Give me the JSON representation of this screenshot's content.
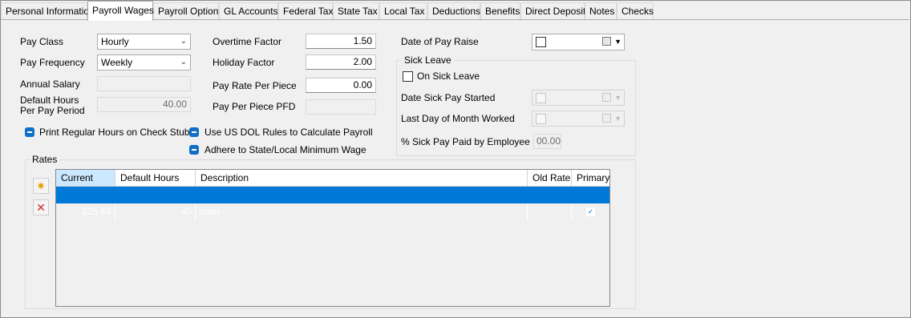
{
  "tabs": [
    {
      "label": "Personal Information"
    },
    {
      "label": "Payroll Wages"
    },
    {
      "label": "Payroll Options"
    },
    {
      "label": "GL Accounts"
    },
    {
      "label": "Federal Tax"
    },
    {
      "label": "State Tax"
    },
    {
      "label": "Local Tax"
    },
    {
      "label": "Deductions"
    },
    {
      "label": "Benefits"
    },
    {
      "label": "Direct Deposit"
    },
    {
      "label": "Notes"
    },
    {
      "label": "Checks"
    }
  ],
  "active_tab": "Payroll Wages",
  "left": {
    "pay_class_label": "Pay Class",
    "pay_class_value": "Hourly",
    "pay_frequency_label": "Pay Frequency",
    "pay_frequency_value": "Weekly",
    "annual_salary_label": "Annual Salary",
    "annual_salary_value": "",
    "default_hours_label_1": "Default Hours",
    "default_hours_label_2": "Per Pay Period",
    "default_hours_value": "40.00"
  },
  "middle": {
    "overtime_factor_label": "Overtime Factor",
    "overtime_factor_value": "1.50",
    "holiday_factor_label": "Holiday Factor",
    "holiday_factor_value": "2.00",
    "pay_rate_per_piece_label": "Pay Rate Per Piece",
    "pay_rate_per_piece_value": "0.00",
    "pay_per_piece_pfd_label": "Pay Per Piece PFD",
    "pay_per_piece_pfd_value": ""
  },
  "right": {
    "date_of_pay_raise_label": "Date of Pay Raise",
    "sick_leave_title": "Sick Leave",
    "on_sick_leave_label": "On Sick Leave",
    "date_sick_pay_started_label": "Date Sick Pay Started",
    "last_day_worked_label": "Last Day of Month Worked",
    "pct_sick_pay_label": "% Sick Pay Paid by Employee",
    "pct_sick_pay_value": "00.00"
  },
  "options": {
    "print_regular_hours": "Print Regular Hours on Check Stub",
    "use_us_dol": "Use US DOL Rules to Calculate Payroll",
    "adhere_min_wage": "Adhere to State/Local Minimum Wage"
  },
  "rates": {
    "title": "Rates",
    "columns": [
      "Current",
      "Default Hours",
      "Description",
      "Old Rate",
      "Primary"
    ],
    "rows": [
      {
        "current": "$25.65",
        "default_hours": "40",
        "description": "main",
        "old_rate": "",
        "primary": true
      }
    ]
  },
  "colors": {
    "selection": "#0078d7",
    "checkbox_blue": "#0f6fc6",
    "header_selected": "#cce8ff"
  }
}
